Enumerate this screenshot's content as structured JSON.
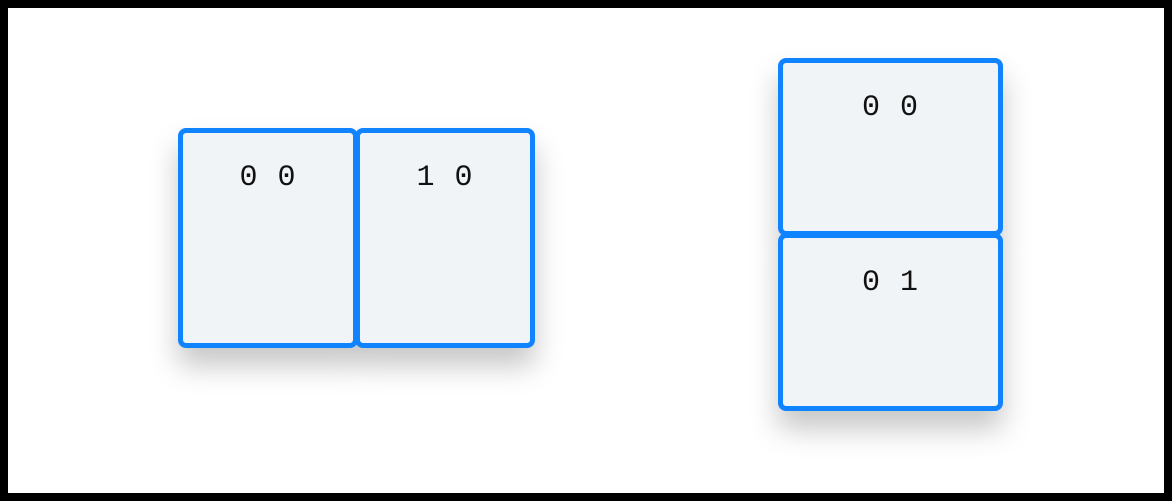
{
  "diagram": {
    "groups": [
      {
        "orientation": "horizontal",
        "cards": [
          {
            "label": "0 0"
          },
          {
            "label": "1 0"
          }
        ]
      },
      {
        "orientation": "vertical",
        "cards": [
          {
            "label": "0 0"
          },
          {
            "label": "0 1"
          }
        ]
      }
    ]
  }
}
